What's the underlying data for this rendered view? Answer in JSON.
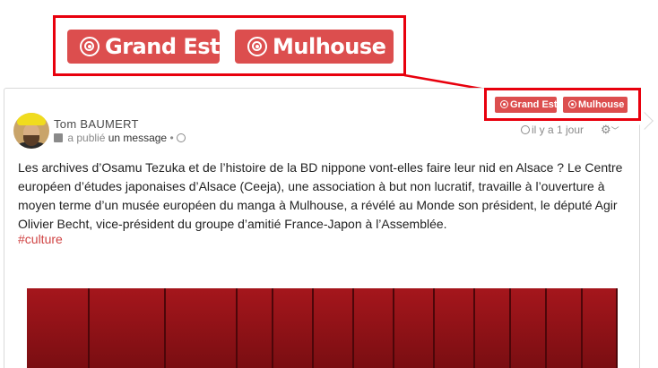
{
  "zoom_callout": {
    "tags": [
      {
        "label": "Grand Est",
        "icon": "target-icon"
      },
      {
        "label": "Mulhouse",
        "icon": "target-icon"
      }
    ]
  },
  "post": {
    "tags": [
      {
        "label": "Grand Est",
        "icon": "target-icon"
      },
      {
        "label": "Mulhouse",
        "icon": "target-icon"
      }
    ],
    "author": "Tom BAUMERT",
    "meta_prefix": "a publié",
    "meta_link": "un message",
    "meta_sep": "•",
    "time": "il y a 1 jour",
    "text": "Les archives d’Osamu Tezuka et de l’histoire de la BD nippone vont-elles faire leur nid en Alsace ? Le Centre européen d’études japonaises d’Alsace (Ceeja), une association à but non lucratif, travaille à l’ouverture à moyen terme d’un musée européen du manga à Mulhouse, a révélé au Monde son président, le député Agir Olivier Becht, vice-président du groupe d’amitié France-Japon à l’Assemblée.",
    "hashtag": "#culture",
    "settings_icon": "gear-icon"
  },
  "colors": {
    "tag_bg": "#dc4e4e",
    "highlight": "#e8000d",
    "hashtag": "#d04444"
  }
}
